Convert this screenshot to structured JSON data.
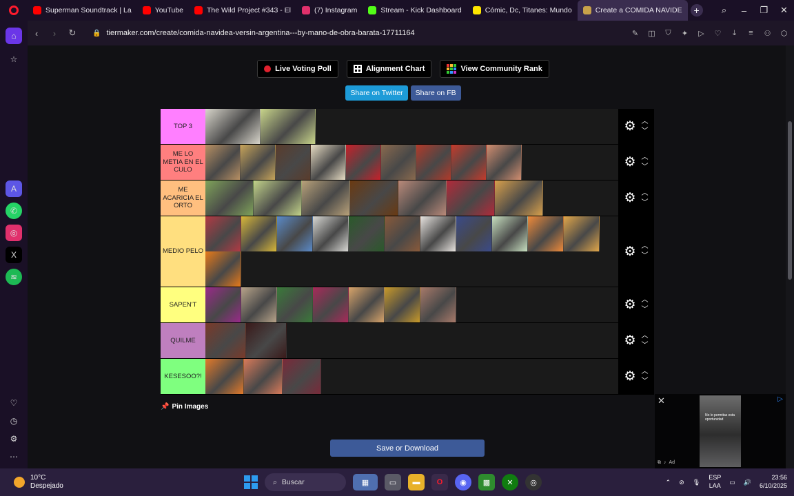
{
  "browser": {
    "tabs": [
      {
        "label": "Superman Soundtrack | La",
        "favicon_color": "#ff0000",
        "active": false
      },
      {
        "label": "YouTube",
        "favicon_color": "#ff0000",
        "active": false
      },
      {
        "label": "The Wild Project #343 - El",
        "favicon_color": "#ff0000",
        "active": false
      },
      {
        "label": "(7) Instagram",
        "favicon_color": "#e1306c",
        "active": false
      },
      {
        "label": "Stream - Kick Dashboard",
        "favicon_color": "#53fc18",
        "active": false
      },
      {
        "label": "Cómic, Dc, Titanes: Mundo",
        "favicon_color": "#ffe600",
        "active": false
      },
      {
        "label": "Create a COMIDA NAVIDE",
        "favicon_color": "#c8a24a",
        "active": true
      }
    ],
    "url": "tiermaker.com/create/comida-navidea-versin-argentina---by-mano-de-obra-barata-17711164"
  },
  "toolbar": {
    "live_poll_label": "Live Voting Poll",
    "alignment_label": "Alignment Chart",
    "community_label": "View Community Rank",
    "share_twitter_label": "Share on Twitter",
    "share_fb_label": "Share on FB"
  },
  "tiers": [
    {
      "label": "TOP 3",
      "color": "#ff7fff",
      "rows": [
        [
          "#d8d5cb",
          "#c9d58a"
        ]
      ],
      "item_width": 80
    },
    {
      "label": "ME LO METIA EN EL CULO",
      "color": "#ff7f7f",
      "rows": [
        [
          "#b89063",
          "#c7a45a",
          "#5a3c2c",
          "#e8ddc4",
          "#c8202a",
          "#8a6a4e",
          "#b13a2a",
          "#c53b2c",
          "#d28e70"
        ]
      ],
      "item_width": 51
    },
    {
      "label": "ME ACARICIA EL ORTO",
      "color": "#ffbf7f",
      "rows": [
        [
          "#7fa35a",
          "#c3d48a",
          "#b9a27a",
          "#6a3a12",
          "#ba8a7a",
          "#b22a3a",
          "#d8a04c"
        ]
      ],
      "item_width": 70
    },
    {
      "label": "MEDIO PELO",
      "color": "#ffdf7f",
      "rows": [
        [
          "#b23a44",
          "#d8b83a",
          "#5a8ac8",
          "#d8d8d4",
          "#2a5a2a",
          "#8a5a3a",
          "#e8e4e0",
          "#3a4a8a",
          "#c8e0c0",
          "#ee8a3a",
          "#e0a64a"
        ],
        [
          "#e77a1a"
        ]
      ],
      "item_width": 52
    },
    {
      "label": "SAPEN'T",
      "color": "#ffff7f",
      "rows": [
        [
          "#9a2a8a",
          "#b8a48a",
          "#3a7a3a",
          "#a82a5a",
          "#d8a46a",
          "#c89a2a",
          "#a87a6a"
        ]
      ],
      "item_width": 52
    },
    {
      "label": "QUILME",
      "color": "#bf7fbf",
      "rows": [
        [
          "#7a3a2a",
          "#3a1a1a"
        ]
      ],
      "item_width": 59
    },
    {
      "label": "KESESOO?!",
      "color": "#7fff7f",
      "rows": [
        [
          "#e27a2a",
          "#d87a5a",
          "#7a2a3a"
        ]
      ],
      "item_width": 56
    }
  ],
  "pin_label": "Pin Images",
  "save_label": "Save or Download",
  "ad": {
    "thumb_text": "No lo permitas esta oportunidad",
    "ad_label": "Ad"
  },
  "taskbar": {
    "temperature": "10°C",
    "weather": "Despejado",
    "search_placeholder": "Buscar",
    "lang_top": "ESP",
    "lang_bottom": "LAA",
    "time": "23:56",
    "date": "6/10/2025"
  }
}
